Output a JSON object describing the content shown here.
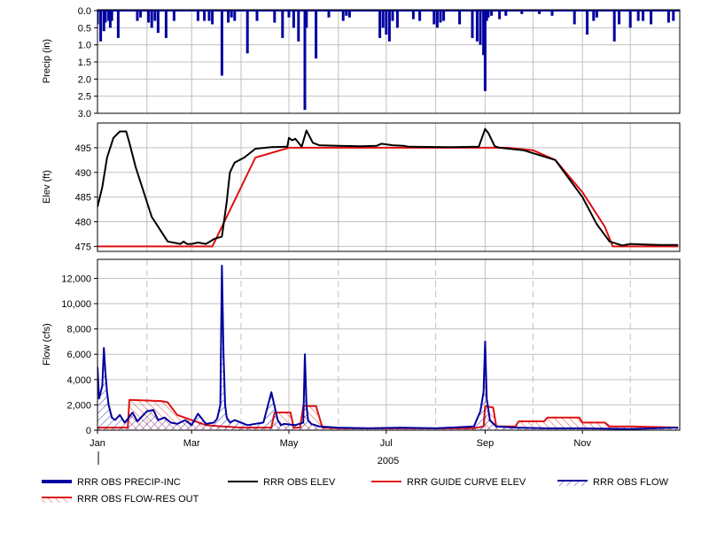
{
  "colors": {
    "precip": "#0000a0",
    "elev": "#000000",
    "guide": "#e01010",
    "flow": "#0000a0",
    "flow_res_out": "#e01010",
    "grid": "#c0c0c0",
    "frame": "#000000"
  },
  "chart_data": [
    {
      "type": "bar",
      "panel": "precip",
      "ylabel": "Precip (in)",
      "ylim": [
        0,
        3
      ],
      "y_inverted": true,
      "yticks": [
        "0.0",
        "0.5",
        "1.0",
        "1.5",
        "2.0",
        "2.5",
        "3.0"
      ],
      "series": [
        {
          "name": "RRR OBS PRECIP-INC",
          "x": [
            "2005-01-01",
            "2005-01-03",
            "2005-01-05",
            "2005-01-06",
            "2005-01-08",
            "2005-01-09",
            "2005-01-10",
            "2005-01-14",
            "2005-01-26",
            "2005-01-28",
            "2005-02-02",
            "2005-02-04",
            "2005-02-06",
            "2005-02-08",
            "2005-02-13",
            "2005-02-18",
            "2005-03-05",
            "2005-03-09",
            "2005-03-12",
            "2005-03-14",
            "2005-03-20",
            "2005-03-24",
            "2005-03-26",
            "2005-03-28",
            "2005-04-05",
            "2005-04-11",
            "2005-04-22",
            "2005-04-27",
            "2005-05-01",
            "2005-05-04",
            "2005-05-07",
            "2005-05-11",
            "2005-05-12",
            "2005-05-18",
            "2005-05-26",
            "2005-06-04",
            "2005-06-06",
            "2005-06-08",
            "2005-06-27",
            "2005-06-29",
            "2005-07-01",
            "2005-07-03",
            "2005-07-05",
            "2005-07-08",
            "2005-07-18",
            "2005-07-22",
            "2005-07-31",
            "2005-08-02",
            "2005-08-04",
            "2005-08-06",
            "2005-08-16",
            "2005-08-24",
            "2005-08-27",
            "2005-08-29",
            "2005-08-31",
            "2005-09-01",
            "2005-09-02",
            "2005-09-03",
            "2005-09-05",
            "2005-09-10",
            "2005-09-14",
            "2005-09-24",
            "2005-10-05",
            "2005-10-13",
            "2005-10-27",
            "2005-11-04",
            "2005-11-08",
            "2005-11-10",
            "2005-11-21",
            "2005-11-24",
            "2005-12-01",
            "2005-12-06",
            "2005-12-09",
            "2005-12-14",
            "2005-12-25",
            "2005-12-28"
          ],
          "values": [
            0.4,
            0.9,
            0.6,
            0.35,
            0.3,
            0.5,
            0.3,
            0.8,
            0.3,
            0.2,
            0.35,
            0.5,
            0.3,
            0.65,
            0.8,
            0.3,
            0.3,
            0.3,
            0.3,
            0.4,
            1.9,
            0.35,
            0.2,
            0.3,
            1.25,
            0.3,
            0.35,
            0.8,
            0.2,
            0.5,
            0.9,
            2.9,
            0.5,
            1.4,
            0.2,
            0.3,
            0.15,
            0.2,
            0.8,
            0.5,
            0.7,
            0.9,
            0.3,
            0.5,
            0.25,
            0.3,
            0.4,
            0.5,
            0.35,
            0.3,
            0.4,
            0.8,
            0.9,
            1.0,
            1.3,
            2.35,
            0.3,
            0.2,
            0.15,
            0.25,
            0.15,
            0.1,
            0.1,
            0.15,
            0.4,
            0.7,
            0.3,
            0.2,
            0.9,
            0.4,
            0.5,
            0.3,
            0.3,
            0.4,
            0.35,
            0.3
          ]
        }
      ]
    },
    {
      "type": "line",
      "panel": "elevation",
      "ylabel": "Elev (ft)",
      "ylim": [
        474,
        500
      ],
      "yticks": [
        "475",
        "480",
        "485",
        "490",
        "495"
      ],
      "series": [
        {
          "name": "RRR OBS ELEV",
          "x": [
            "2005-01-01",
            "2005-01-04",
            "2005-01-07",
            "2005-01-11",
            "2005-01-15",
            "2005-01-19",
            "2005-01-21",
            "2005-01-25",
            "2005-02-04",
            "2005-02-14",
            "2005-02-22",
            "2005-02-24",
            "2005-02-26",
            "2005-03-01",
            "2005-03-05",
            "2005-03-10",
            "2005-03-15",
            "2005-03-20",
            "2005-03-23",
            "2005-03-25",
            "2005-03-28",
            "2005-04-03",
            "2005-04-10",
            "2005-04-20",
            "2005-04-30",
            "2005-05-01",
            "2005-05-03",
            "2005-05-05",
            "2005-05-09",
            "2005-05-12",
            "2005-05-16",
            "2005-05-20",
            "2005-06-01",
            "2005-06-15",
            "2005-06-25",
            "2005-06-28",
            "2005-07-05",
            "2005-07-12",
            "2005-07-15",
            "2005-08-10",
            "2005-08-28",
            "2005-09-01",
            "2005-09-03",
            "2005-09-07",
            "2005-09-10",
            "2005-09-25",
            "2005-10-15",
            "2005-11-01",
            "2005-11-10",
            "2005-11-18",
            "2005-11-26",
            "2005-12-01",
            "2005-12-10",
            "2005-12-20",
            "2005-12-31"
          ],
          "values": [
            483,
            487,
            493,
            497,
            498.3,
            498.3,
            496,
            491,
            481,
            476,
            475.5,
            476,
            475.5,
            475.5,
            475.8,
            475.5,
            476.5,
            477,
            484,
            490,
            492,
            493,
            494.8,
            495.1,
            495.2,
            497,
            496.5,
            496.8,
            495.2,
            498.5,
            496,
            495.5,
            495.4,
            495.3,
            495.4,
            495.8,
            495.5,
            495.4,
            495.2,
            495.1,
            495.2,
            498.8,
            498,
            495.3,
            495,
            494.5,
            492.5,
            485,
            479.5,
            476,
            475.2,
            475.5,
            475.4,
            475.3,
            475.3
          ]
        },
        {
          "name": "RRR GUIDE CURVE ELEV",
          "x": [
            "2005-01-01",
            "2005-03-14",
            "2005-04-10",
            "2005-05-01",
            "2005-09-15",
            "2005-10-01",
            "2005-10-15",
            "2005-11-01",
            "2005-11-15",
            "2005-11-20",
            "2005-12-31"
          ],
          "values": [
            475,
            475,
            493,
            495,
            495,
            494.5,
            492.5,
            486,
            479,
            475,
            475
          ]
        }
      ]
    },
    {
      "type": "area",
      "panel": "flow",
      "ylabel": "Flow (cfs)",
      "ylim": [
        0,
        13500
      ],
      "yticks": [
        "0",
        "2,000",
        "4,000",
        "6,000",
        "8,000",
        "10,000",
        "12,000"
      ],
      "xticks": [
        "Jan",
        "Mar",
        "May",
        "Jul",
        "Sep",
        "Nov"
      ],
      "xlabel": "2005",
      "series": [
        {
          "name": "RRR OBS FLOW",
          "x": [
            "2005-01-01",
            "2005-01-02",
            "2005-01-03",
            "2005-01-04",
            "2005-01-05",
            "2005-01-06",
            "2005-01-07",
            "2005-01-08",
            "2005-01-09",
            "2005-01-10",
            "2005-01-12",
            "2005-01-15",
            "2005-01-18",
            "2005-01-20",
            "2005-01-23",
            "2005-01-26",
            "2005-02-01",
            "2005-02-05",
            "2005-02-08",
            "2005-02-12",
            "2005-02-16",
            "2005-02-20",
            "2005-02-25",
            "2005-03-01",
            "2005-03-05",
            "2005-03-10",
            "2005-03-15",
            "2005-03-17",
            "2005-03-19",
            "2005-03-20",
            "2005-03-21",
            "2005-03-22",
            "2005-03-23",
            "2005-03-25",
            "2005-03-28",
            "2005-04-05",
            "2005-04-15",
            "2005-04-20",
            "2005-04-24",
            "2005-04-26",
            "2005-04-28",
            "2005-05-05",
            "2005-05-10",
            "2005-05-11",
            "2005-05-12",
            "2005-05-13",
            "2005-05-15",
            "2005-05-20",
            "2005-06-01",
            "2005-06-20",
            "2005-07-10",
            "2005-08-01",
            "2005-08-25",
            "2005-08-29",
            "2005-08-31",
            "2005-09-01",
            "2005-09-02",
            "2005-09-04",
            "2005-09-08",
            "2005-09-20",
            "2005-10-10",
            "2005-11-01",
            "2005-12-01",
            "2005-12-31"
          ],
          "values": [
            5000,
            2500,
            3000,
            3500,
            6500,
            4500,
            3000,
            2000,
            1500,
            1000,
            800,
            1200,
            600,
            900,
            1400,
            700,
            1500,
            1600,
            800,
            1000,
            600,
            500,
            800,
            400,
            1300,
            500,
            600,
            900,
            2000,
            13000,
            6000,
            2000,
            1000,
            600,
            800,
            400,
            600,
            3000,
            800,
            400,
            500,
            400,
            600,
            6000,
            2000,
            800,
            500,
            300,
            200,
            150,
            200,
            150,
            300,
            1500,
            3000,
            7000,
            2500,
            800,
            300,
            200,
            150,
            150,
            100,
            200
          ]
        },
        {
          "name": "RRR OBS FLOW-RES OUT",
          "x": [
            "2005-01-01",
            "2005-01-20",
            "2005-01-21",
            "2005-02-10",
            "2005-02-14",
            "2005-02-20",
            "2005-03-01",
            "2005-03-10",
            "2005-03-20",
            "2005-04-01",
            "2005-04-20",
            "2005-04-22",
            "2005-05-02",
            "2005-05-04",
            "2005-05-08",
            "2005-05-10",
            "2005-05-18",
            "2005-05-22",
            "2005-06-01",
            "2005-07-01",
            "2005-08-25",
            "2005-08-31",
            "2005-09-01",
            "2005-09-06",
            "2005-09-08",
            "2005-09-20",
            "2005-09-22",
            "2005-10-08",
            "2005-10-10",
            "2005-10-30",
            "2005-11-01",
            "2005-11-15",
            "2005-11-18",
            "2005-12-01",
            "2005-12-31"
          ],
          "values": [
            200,
            200,
            2400,
            2300,
            2200,
            1200,
            800,
            400,
            300,
            200,
            200,
            1400,
            1400,
            200,
            200,
            1900,
            1900,
            200,
            150,
            150,
            150,
            300,
            1900,
            1800,
            300,
            300,
            700,
            700,
            1000,
            1000,
            600,
            600,
            300,
            300,
            200
          ]
        }
      ]
    }
  ],
  "legend": [
    {
      "label": "RRR OBS PRECIP-INC",
      "style": "thick-bar"
    },
    {
      "label": "RRR OBS ELEV",
      "style": "line-black"
    },
    {
      "label": "RRR GUIDE CURVE ELEV",
      "style": "line-red"
    },
    {
      "label": "RRR OBS FLOW",
      "style": "hatch-blue"
    },
    {
      "label": "RRR OBS FLOW-RES OUT",
      "style": "hatch-red"
    }
  ]
}
